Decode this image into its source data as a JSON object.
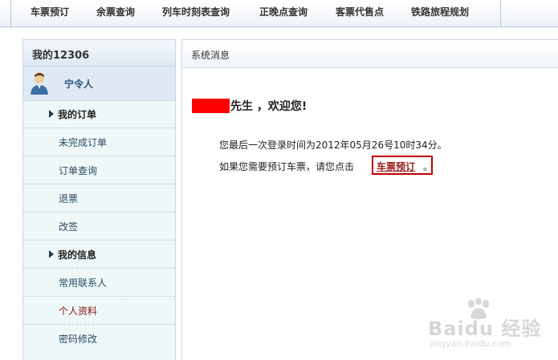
{
  "top_nav": {
    "items": [
      "车票预订",
      "余票查询",
      "列车时刻表查询",
      "正晚点查询",
      "客票代售点",
      "铁路旅程规划"
    ]
  },
  "sidebar": {
    "title": "我的12306",
    "username": "宁令人",
    "sections": [
      {
        "label": "我的订单",
        "links": [
          "未完成订单",
          "订单查询",
          "退票",
          "改签"
        ]
      },
      {
        "label": "我的信息",
        "links": [
          "常用联系人",
          "个人资料",
          "密码修改"
        ]
      }
    ],
    "active_link": "个人资料"
  },
  "main": {
    "title": "系统消息",
    "welcome": "先生 ，欢迎您!",
    "last_login": "您最后一次登录时间为2012年05月26号10时34分。",
    "book_prompt": "如果您需要预订车票，请您点击",
    "book_link": "车票预订",
    "book_suffix": "。"
  },
  "watermark": {
    "brand": "Baidu 经验",
    "url": "jingyan.baidu.com"
  },
  "colors": {
    "accent_red": "#c00000",
    "redaction": "#ff0000",
    "sidebar_bg": "#eef8f8"
  }
}
